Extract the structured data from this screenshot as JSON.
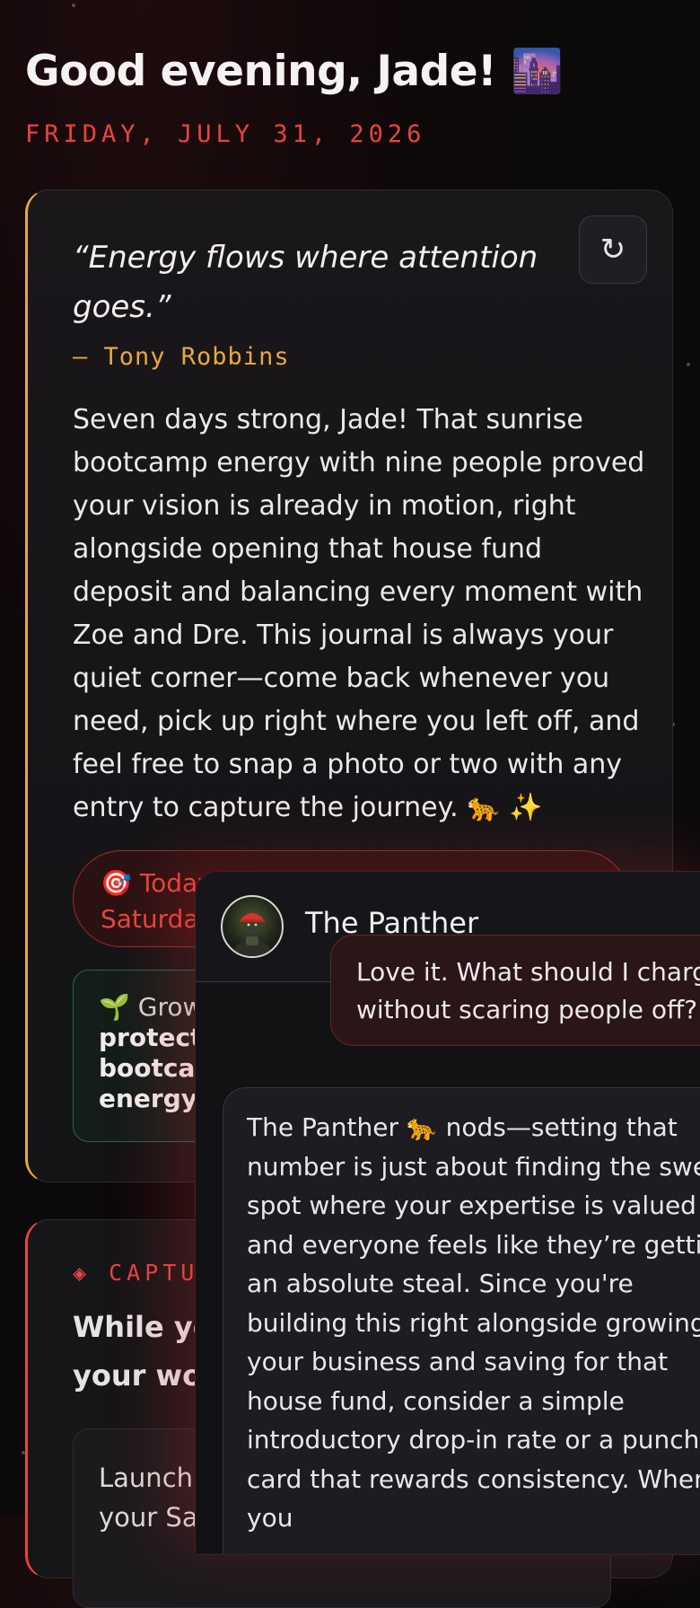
{
  "header": {
    "greeting": "Good evening, Jade! 🌆",
    "date": "FRIDAY, JULY 31, 2026"
  },
  "quote_card": {
    "quote": "“Energy flows where attention goes.”",
    "author": "— Tony Robbins",
    "refresh_icon": "↻",
    "summary": "Seven days strong, Jade! That sunrise bootcamp energy with nine people proved your vision is already in motion, right alongside opening that house fund deposit and balancing every moment with Zoe and Dre. This journal is always your quiet corner—come back whenever you need, pick up right where you left off, and feel free to snap a photo or two with any entry to capture the journey. 🐆 ✨",
    "focus_icon": "🎯",
    "focus_text_line1": "Today",
    "focus_text_line2": "Saturda",
    "grow_icon": "🌱",
    "grow_label": "Grow",
    "grow_bold_1": "protect",
    "grow_bold_2": "bootca",
    "grow_bold_3": "energy"
  },
  "capture_card": {
    "label": "◈ CAPTU",
    "question_line1": "While yo",
    "question_line2": "your wo",
    "box_text_line1": "Launch",
    "box_text_line2": "your Sa"
  },
  "chat": {
    "name": "The Panther",
    "user_message": "Love it. What should I charge without scaring people off?",
    "bot_message": "The Panther 🐆 nods—setting that number is just about finding the sweet spot where your expertise is valued and everyone feels like they’re getting an absolute steal. Since you're building this right alongside growing your business and saving for that house fund, consider a simple introductory drop-in rate or a punch card that rewards consistency. When you"
  },
  "colors": {
    "accent_red": "#e8443e",
    "accent_gold": "#e9a83d",
    "accent_green": "#1f6a4c",
    "background": "#0a0a0c"
  }
}
